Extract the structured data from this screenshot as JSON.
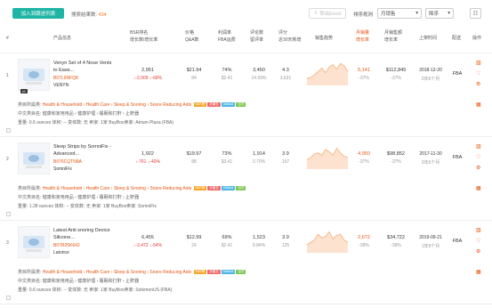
{
  "toolbar": {
    "add_label": "加入到跟进列表",
    "result_prefix": "搜索结果数:",
    "result_count": "434",
    "export_label": "导出Excel",
    "sort_label": "排序规则",
    "sort_value": "月销售",
    "order_value": "降序"
  },
  "header": {
    "index": "#",
    "product": "产品信息",
    "bsr": "BSR排名",
    "bsr_growth": "增长数/增长率",
    "price": "价格",
    "qa": "Q&A数",
    "gross": "利润率",
    "fba": "FBA运费",
    "reviews": "评论数",
    "review_rate": "留评率",
    "rating": "评分",
    "new_reviews": "近30天新增",
    "trend": "销售趋势",
    "month_sales": "月销量",
    "month_sales_growth": "增长率",
    "month_revenue": "月销售额",
    "month_revenue_growth": "增长率",
    "launch": "上架时间",
    "delivery": "配送",
    "action": "操作"
  },
  "rows": [
    {
      "index": "1",
      "title": "Venyn Set of 4 Nose Vents to Ease...",
      "asin": "B07L9NFQ8",
      "brand": "VENYN",
      "badge": "AC",
      "bsr": "2,951",
      "bsr_change": "↓-2,009 ↓-68%",
      "price": "$21.94",
      "qa": "84",
      "gross": "74%",
      "fba": "$2.41",
      "reviews": "3,450",
      "review_rate": "14.59%",
      "rating": "4.3",
      "new_reviews": "3,631",
      "month_sales": "5,141",
      "month_sales_growth": "-37%",
      "month_revenue": "$112,845",
      "month_revenue_growth": "-37%",
      "launch": "2018-12-20",
      "launch_age": "2年6个月",
      "delivery": "FBA",
      "category": "Health & Household › Health Care › Sleep & Snoring › Snore Reducing Aids",
      "category_label": "类目所属类:",
      "cn_category": "中文类目名: 健康和家用用品 › 健康护理 › 睡眠和打鼾 › 止鼾器",
      "specs": "重量: 0.6 ounces    体积: --    变体数: 无    卖家: 1家    BuyBox卖家: Atrium Plaza (FBA)",
      "trend": [
        0.3,
        0.35,
        0.45,
        0.6,
        0.75,
        0.55,
        0.8,
        0.9,
        0.7,
        0.95,
        0.85,
        0.6
      ]
    },
    {
      "index": "2",
      "title": "Sleep Strips by SomniFix - Advanced...",
      "asin": "B076CQTN8A",
      "brand": "SomniFix",
      "badge": "",
      "bsr": "1,922",
      "bsr_change": "↓-761 ↓-40%",
      "price": "$19.97",
      "qa": "88",
      "gross": "73%",
      "fba": "$3.41",
      "reviews": "1,914",
      "review_rate": "3.70%",
      "rating": "3.9",
      "new_reviews": "157",
      "month_sales": "4,950",
      "month_sales_growth": "-37%",
      "month_revenue": "$98,852",
      "month_revenue_growth": "-37%",
      "launch": "2017-11-30",
      "launch_age": "3年6个月",
      "delivery": "FBA",
      "category": "Health & Household › Health Care › Sleep & Snoring › Snore Reducing Aids",
      "category_label": "类目所属类:",
      "cn_category": "中文类目名: 健康和家用用品 › 健康护理 › 睡眠和打鼾 › 止鼾器",
      "specs": "重量: 1.28 ounces    体积: --    变体数: 无    卖家: 1家    BuyBox卖家: SomniFix",
      "trend": [
        0.4,
        0.5,
        0.65,
        0.7,
        0.6,
        0.85,
        0.75,
        0.6,
        0.9,
        0.7,
        0.55,
        0.5
      ]
    },
    {
      "index": "3",
      "title": "Latest Anti snoring Device Silicone...",
      "asin": "B07R25K642",
      "brand": "Latorice",
      "badge": "",
      "bsr": "6,455",
      "bsr_change": "↓-3,472 ↓-54%",
      "price": "$12.99",
      "qa": "24",
      "gross": "69%",
      "fba": "$2.41",
      "reviews": "1,523",
      "review_rate": "9.84%",
      "rating": "3.9",
      "new_reviews": "125",
      "month_sales": "2,672",
      "month_sales_growth": "-39%",
      "month_revenue": "$34,722",
      "month_revenue_growth": "-39%",
      "launch": "2019-09-21",
      "launch_age": "1年9个月",
      "delivery": "FBA",
      "category": "Health & Household › Health Care › Sleep & Snoring › Snore Reducing Aids",
      "category_label": "类目所属类:",
      "cn_category": "中文类目名: 健康和家用用品 › 健康护理 › 睡眠和打鼾 › 止鼾器",
      "specs": "重量: 0.6 ounces    体积: --    变体数: 无    卖家: 1家    BuyBox卖家: SolomonUS (FBA)",
      "trend": [
        0.35,
        0.45,
        0.55,
        0.8,
        0.65,
        0.7,
        0.9,
        0.6,
        0.75,
        0.8,
        0.55,
        0.45
      ]
    }
  ],
  "tags": [
    "BSR榜",
    "月增长",
    "Alibaba",
    "百货"
  ],
  "colors": {
    "accent": "#e8540f",
    "teal": "#1fb5a4",
    "spark": "#f9b98a",
    "down": "#e53935"
  }
}
